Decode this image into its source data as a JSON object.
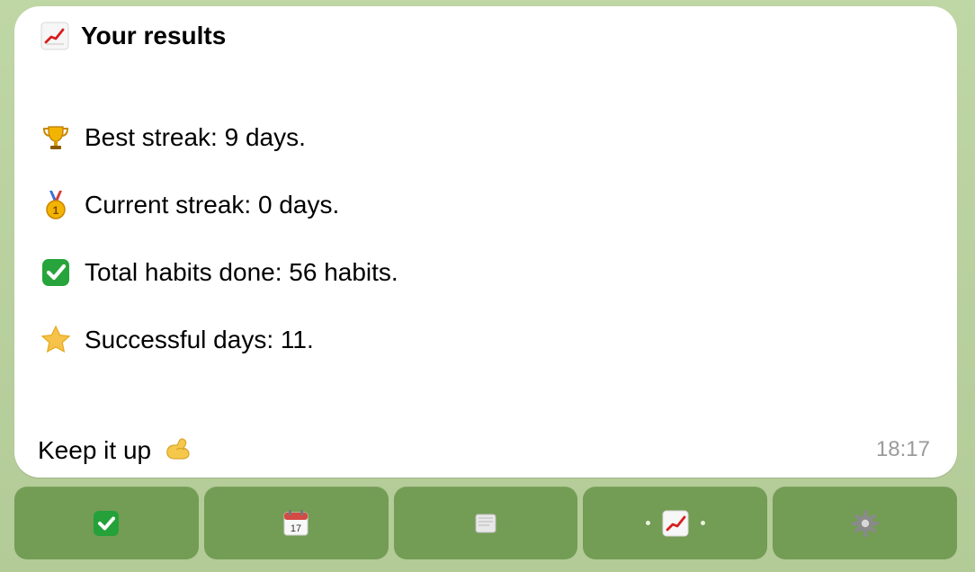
{
  "message": {
    "title": "Your results",
    "lines": [
      {
        "text": "Best streak: 9 days.",
        "icon": "trophy-icon"
      },
      {
        "text": "Current streak: 0 days.",
        "icon": "first-place-medal-icon"
      },
      {
        "text": "Total habits done: 56 habits.",
        "icon": "check-mark-button-icon"
      },
      {
        "text": "Successful days: 11.",
        "icon": "star-icon"
      }
    ],
    "footer": "Keep it up",
    "time": "18:17"
  },
  "keyboard": {
    "buttons": [
      {
        "icon": "check-mark-button-icon"
      },
      {
        "icon": "calendar-icon"
      },
      {
        "icon": "scroll-icon"
      },
      {
        "icon": "chart-increasing-icon",
        "active": true
      },
      {
        "icon": "gear-icon"
      }
    ]
  },
  "colors": {
    "background": "#b7cf9c",
    "bubble": "#ffffff",
    "keyboard_button": "#6c9a4a",
    "time_text": "#9a9a9a"
  }
}
